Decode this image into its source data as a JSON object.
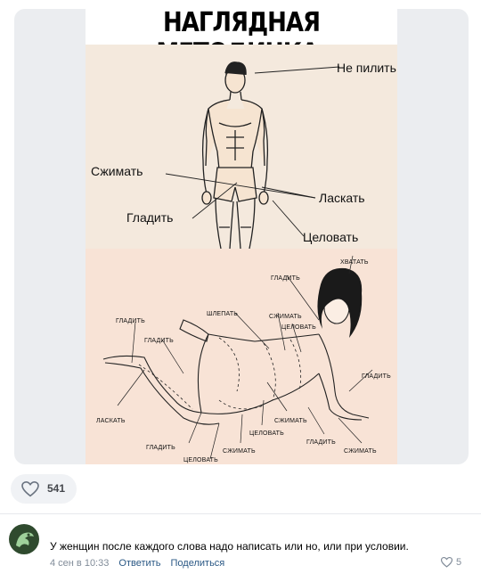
{
  "meme": {
    "title": "НАГЛЯДНАЯ МЕТОДИЧКА:",
    "male_labels": {
      "dont_nag": "Не пилить",
      "squeeze": "Сжимать",
      "caress": "Ласкать",
      "stroke": "Гладить",
      "kiss": "Целовать"
    },
    "female_labels": {
      "grab": "ХВАТАТЬ",
      "stroke_head": "ГЛАДИТЬ",
      "slap": "ШЛЕПАТЬ",
      "squeeze_back": "СЖИМАТЬ",
      "kiss_back": "ЦЕЛОВАТЬ",
      "stroke_leg": "ГЛАДИТЬ",
      "stroke_calf": "ГЛАДИТЬ",
      "stroke_arm": "ГЛАДИТЬ",
      "caress_foot": "ЛАСКАТЬ",
      "squeeze_belly": "СЖИМАТЬ",
      "kiss_belly": "ЦЕЛОВАТЬ",
      "stroke_knee": "ГЛАДИТЬ",
      "squeeze_thigh": "СЖИМАТЬ",
      "stroke_arm_low": "ГЛАДИТЬ",
      "squeeze_hand": "СЖИМАТЬ",
      "kiss_knee": "ЦЕЛОВАТЬ"
    }
  },
  "reactions": {
    "likes": "541",
    "icon": "heart-icon"
  },
  "comment": {
    "avatar_icon": "dragon-avatar",
    "text": "У женщин после каждого слова надо написать или но, или при условии.",
    "date": "4 сен в 10:33",
    "reply": "Ответить",
    "share": "Поделиться",
    "likes": "5"
  },
  "colors": {
    "link": "#2a5885",
    "meta": "#818c99",
    "card_bg": "#ebedf0",
    "panel_top": "#f4e9dd",
    "panel_bottom": "#f8e3d6"
  }
}
